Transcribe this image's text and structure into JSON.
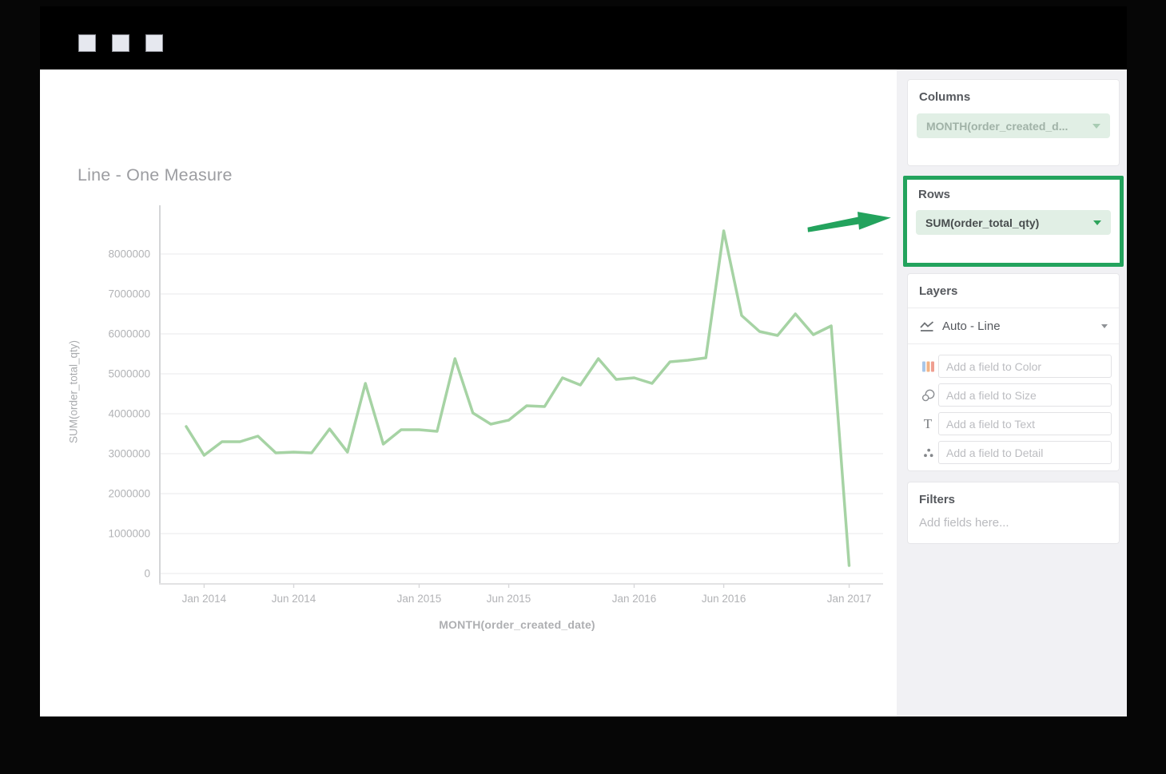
{
  "titlebar": {
    "window_controls": [
      "square",
      "square",
      "square"
    ]
  },
  "chart_data": {
    "type": "line",
    "title": "Line - One Measure",
    "xlabel": "MONTH(order_created_date)",
    "ylabel": "SUM(order_total_qty)",
    "x": [
      "Dec 2013",
      "Jan 2014",
      "Feb 2014",
      "Mar 2014",
      "Apr 2014",
      "May 2014",
      "Jun 2014",
      "Jul 2014",
      "Aug 2014",
      "Sep 2014",
      "Oct 2014",
      "Nov 2014",
      "Dec 2014",
      "Jan 2015",
      "Feb 2015",
      "Mar 2015",
      "Apr 2015",
      "May 2015",
      "Jun 2015",
      "Jul 2015",
      "Aug 2015",
      "Sep 2015",
      "Oct 2015",
      "Nov 2015",
      "Dec 2015",
      "Jan 2016",
      "Feb 2016",
      "Mar 2016",
      "Apr 2016",
      "May 2016",
      "Jun 2016",
      "Jul 2016",
      "Aug 2016",
      "Sep 2016",
      "Oct 2016",
      "Nov 2016",
      "Dec 2016",
      "Jan 2017"
    ],
    "values": [
      3680000,
      2960000,
      3300000,
      3300000,
      3440000,
      3020000,
      3040000,
      3020000,
      3620000,
      3040000,
      4760000,
      3240000,
      3600000,
      3600000,
      3560000,
      5380000,
      4020000,
      3740000,
      3840000,
      4200000,
      4180000,
      4900000,
      4720000,
      5380000,
      4860000,
      4900000,
      4760000,
      5300000,
      5340000,
      5400000,
      8580000,
      6460000,
      6060000,
      5960000,
      6500000,
      5980000,
      6200000,
      200000
    ],
    "y_ticks": [
      0,
      1000000,
      2000000,
      3000000,
      4000000,
      5000000,
      6000000,
      7000000,
      8000000
    ],
    "x_ticks": [
      {
        "label": "Jan 2014",
        "i": 1
      },
      {
        "label": "Jun 2014",
        "i": 6
      },
      {
        "label": "Jan 2015",
        "i": 13
      },
      {
        "label": "Jun 2015",
        "i": 18
      },
      {
        "label": "Jan 2016",
        "i": 25
      },
      {
        "label": "Jun 2016",
        "i": 30
      },
      {
        "label": "Jan 2017",
        "i": 37
      }
    ],
    "ylim": [
      0,
      9400000
    ],
    "grid": true,
    "legend_position": "none",
    "line_color": "#a6d3a4"
  },
  "panel": {
    "columns": {
      "header": "Columns",
      "pill_label": "MONTH(order_created_d..."
    },
    "rows": {
      "header": "Rows",
      "pill_label": "SUM(order_total_qty)"
    },
    "layers": {
      "header": "Layers",
      "mark_label": "Auto - Line",
      "fields": [
        {
          "icon": "color-bars-icon",
          "placeholder": "Add a field to Color"
        },
        {
          "icon": "size-circles-icon",
          "placeholder": "Add a field to Size"
        },
        {
          "icon": "text-t-icon",
          "icon_glyph": "T",
          "placeholder": "Add a field to Text"
        },
        {
          "icon": "detail-dots-icon",
          "placeholder": "Add a field to Detail"
        }
      ]
    },
    "filters": {
      "header": "Filters",
      "placeholder": "Add fields here..."
    }
  },
  "colors": {
    "accent_green": "#23a35d",
    "line_green": "#a6d3a4",
    "pill_green_bg": "#e1efe5",
    "panel_bg": "#f1f1f4",
    "titlebar_bg": "#000000"
  }
}
